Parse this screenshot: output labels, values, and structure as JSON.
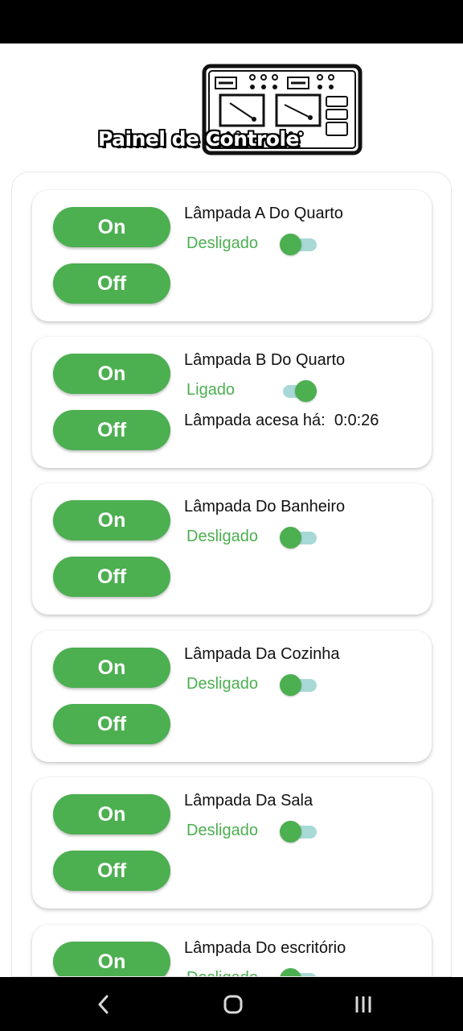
{
  "header": {
    "title": "Painel de Controle",
    "image_icon": "control-panel-icon"
  },
  "buttons": {
    "on_label": "On",
    "off_label": "Off"
  },
  "lamps": [
    {
      "name": "Lâmpada A Do Quarto",
      "status": "Desligado",
      "switch_on": false
    },
    {
      "name": "Lâmpada B Do Quarto",
      "status": "Ligado",
      "switch_on": true,
      "elapsed_label": "Lâmpada acesa há:",
      "elapsed_value": "0:0:26"
    },
    {
      "name": "Lâmpada Do Banheiro",
      "status": "Desligado",
      "switch_on": false
    },
    {
      "name": "Lâmpada Da Cozinha",
      "status": "Desligado",
      "switch_on": false
    },
    {
      "name": "Lâmpada Da Sala",
      "status": "Desligado",
      "switch_on": false
    },
    {
      "name": "Lâmpada Do escritório",
      "status": "Desligado",
      "switch_on": false
    }
  ],
  "nav": {
    "icons": [
      "back-icon",
      "home-icon",
      "recents-icon"
    ]
  },
  "colors": {
    "accent": "#4caf50",
    "switch_track": "#a8d9d6",
    "bars": "#000000"
  }
}
